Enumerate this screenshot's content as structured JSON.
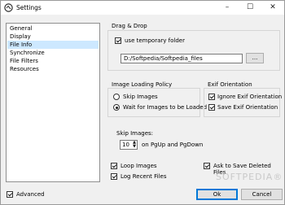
{
  "window": {
    "title": "Settings",
    "minimize": "–",
    "maximize": "☐",
    "close": "✕"
  },
  "sidebar": {
    "items": [
      {
        "label": "General"
      },
      {
        "label": "Display"
      },
      {
        "label": "File Info"
      },
      {
        "label": "Synchronize"
      },
      {
        "label": "File Filters"
      },
      {
        "label": "Resources"
      }
    ],
    "selected_index": 2
  },
  "drag_drop": {
    "heading": "Drag & Drop",
    "use_temp_folder": {
      "label": "use temporary folder",
      "checked": true
    },
    "path": "D:/Softpedia/Softpedia_files",
    "browse": "..."
  },
  "loading_policy": {
    "heading": "Image Loading Policy",
    "options": [
      {
        "label": "Skip Images",
        "selected": false
      },
      {
        "label": "Wait for Images to be Loaded",
        "selected": true
      }
    ]
  },
  "exif": {
    "heading": "Exif Orientation",
    "ignore": {
      "label": "Ignore Exif Orientation",
      "checked": true
    },
    "save": {
      "label": "Save Exif Orientation",
      "checked": true
    }
  },
  "skip_images": {
    "label": "Skip Images:",
    "value": "10",
    "suffix": "on PgUp and PgDown"
  },
  "options": {
    "loop": {
      "label": "Loop Images",
      "checked": true
    },
    "log_recent": {
      "label": "Log Recent Files",
      "checked": true
    },
    "ask_deleted": {
      "label": "Ask to Save Deleted Files",
      "checked": true
    }
  },
  "footer": {
    "advanced": {
      "label": "Advanced",
      "checked": true
    },
    "ok": "Ok",
    "cancel": "Cancel"
  },
  "watermark": "SOFTPEDIA®"
}
